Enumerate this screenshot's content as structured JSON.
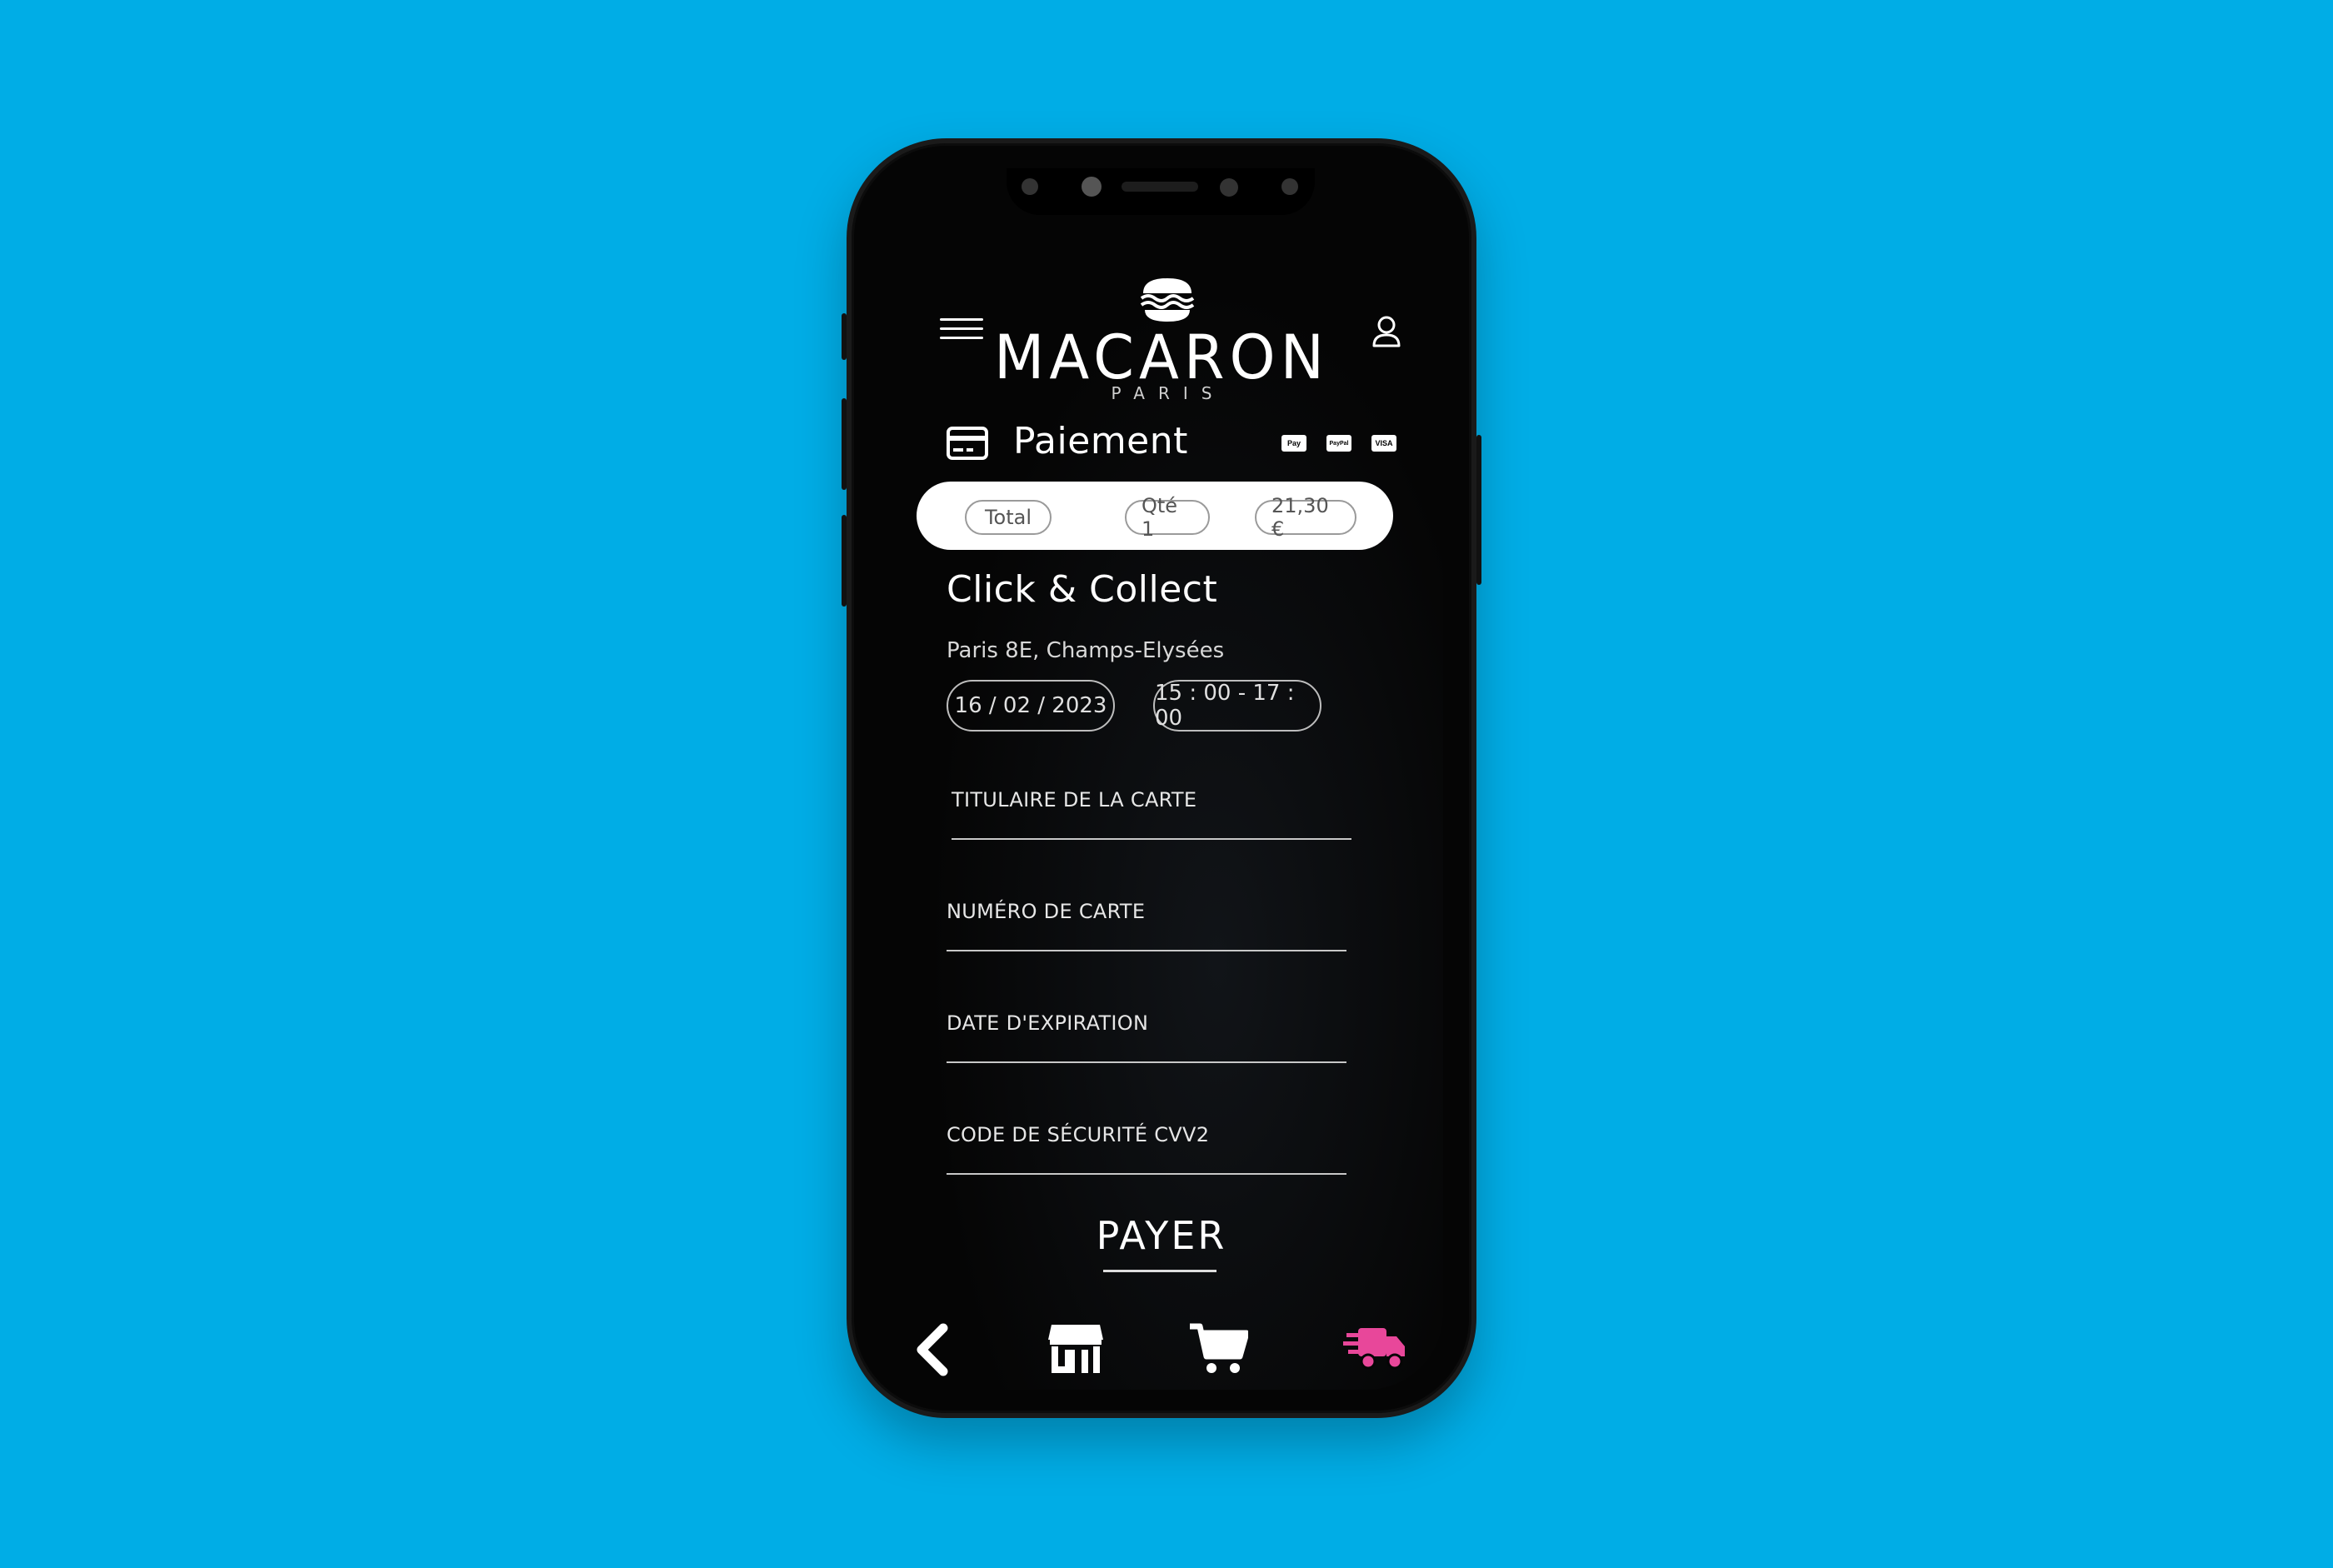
{
  "brand": {
    "name": "MACARON",
    "subtitle": "PARIS"
  },
  "payment": {
    "title": "Paiement",
    "methods": [
      "Pay",
      "PayPal",
      "VISA"
    ]
  },
  "summary": {
    "total_label": "Total",
    "quantity": "Qté 1",
    "amount": "21,30 €"
  },
  "pickup": {
    "title": "Click & Collect",
    "location": "Paris 8E, Champs-Elysées",
    "date": "16 / 02 / 2023",
    "time_slot": "15 : 00 - 17 : 00"
  },
  "form": {
    "cardholder_label": "TITULAIRE DE LA CARTE",
    "card_number_label": "NUMÉRO DE CARTE",
    "expiry_label": "DATE D'EXPIRATION",
    "cvv_label": "CODE DE SÉCURITÉ CVV2",
    "submit_label": "PAYER"
  },
  "nav": {
    "items": [
      "back-icon",
      "store-icon",
      "cart-icon",
      "delivery-truck-icon"
    ],
    "active": "delivery-truck-icon",
    "active_color": "#e8479a"
  },
  "colors": {
    "background": "#00ade6",
    "screen": "#050505",
    "accent": "#e8479a"
  }
}
